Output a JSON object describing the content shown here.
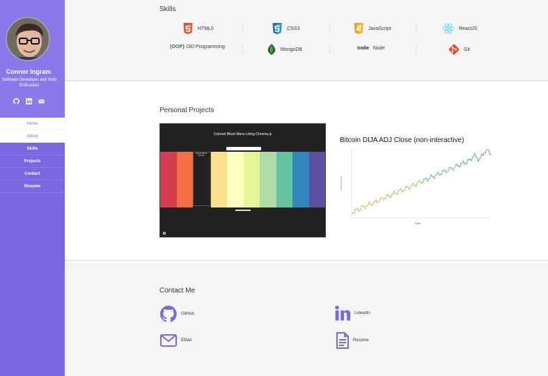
{
  "profile": {
    "name": "Connor Ingram",
    "tagline": "Software Developer and Web Enthusiast"
  },
  "nav": [
    "Home",
    "About",
    "Skills",
    "Projects",
    "Contact",
    "Resume"
  ],
  "skills": {
    "heading": "Skills",
    "items": [
      {
        "label": "HTML5",
        "icon": "html5-icon"
      },
      {
        "label": "CSS3",
        "icon": "css3-icon"
      },
      {
        "label": "JavaScript",
        "icon": "javascript-icon"
      },
      {
        "label": "ReactJS",
        "icon": "react-icon"
      },
      {
        "label": "OO Programming",
        "icon": "oop-icon",
        "badge": "{OOP}"
      },
      {
        "label": "MongoDB",
        "icon": "mongodb-icon"
      },
      {
        "label": "Node",
        "icon": "node-icon",
        "badge": "node"
      },
      {
        "label": "Git",
        "icon": "git-icon"
      }
    ]
  },
  "projects": {
    "heading": "Personal Projects",
    "project1": {
      "title": "Colored Block Menu Using Chroma.js",
      "selected_label": "Selected Block Number"
    },
    "chart": {
      "title": "Bitcoin DIJA ADJ Close (non-interactive)",
      "xlabel": "Date",
      "ylabel": "DIJA Adj Close"
    }
  },
  "contact": {
    "heading": "Contact Me",
    "items": [
      {
        "label": "GitHub",
        "icon": "github-icon"
      },
      {
        "label": "LinkedIn",
        "icon": "linkedin-icon"
      },
      {
        "label": "EMail",
        "icon": "email-icon"
      },
      {
        "label": "Resume",
        "icon": "resume-icon"
      }
    ]
  },
  "colors": {
    "accent": "#7b68e0",
    "chart_blocks": [
      "#d53e4f",
      "#f46d43",
      "#222222",
      "#fee08b",
      "#ffffbf",
      "#e6f598",
      "#abdda4",
      "#66c2a5",
      "#3288bd",
      "#5e4fa2"
    ]
  }
}
